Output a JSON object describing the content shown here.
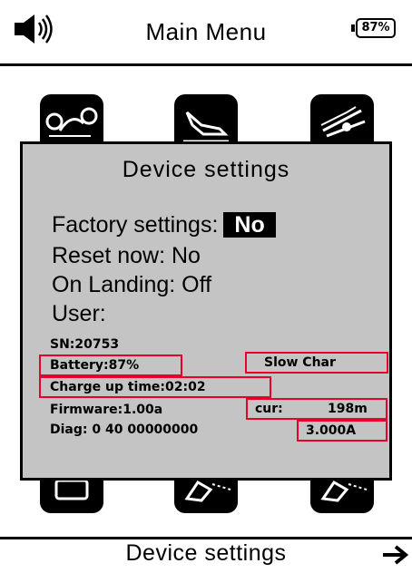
{
  "header": {
    "title": "Main Menu",
    "battery_level": "87%",
    "speaker_icon": "speaker-volume-icon"
  },
  "menu_icons": [
    {
      "name": "route-waypoint-icon"
    },
    {
      "name": "landing-plane-icon"
    },
    {
      "name": "flight-takeoff-icon"
    },
    {
      "name": "display-device-icon"
    },
    {
      "name": "plane-trail-icon"
    },
    {
      "name": "plane-trail-icon"
    }
  ],
  "dialog": {
    "title": "Device settings",
    "factory_label": "Factory settings:",
    "factory_value": "No",
    "reset": "Reset now: No",
    "on_landing": "On Landing: Off",
    "user": "User:",
    "sn": "SN:20753",
    "battery": "Battery:87%",
    "charge_mode": "Slow Char",
    "charge_time": "Charge up time:02:02",
    "firmware": "Firmware:1.00a",
    "cur_label": "cur:",
    "cur_value": "198m",
    "diag": "Diag: 0   40  00000000",
    "current": "3.000A"
  },
  "footer": {
    "label": "Device settings",
    "next_icon": "arrow-right-icon"
  },
  "colors": {
    "dialog_bg": "#c4c4c4",
    "highlight": "#e8002a"
  }
}
